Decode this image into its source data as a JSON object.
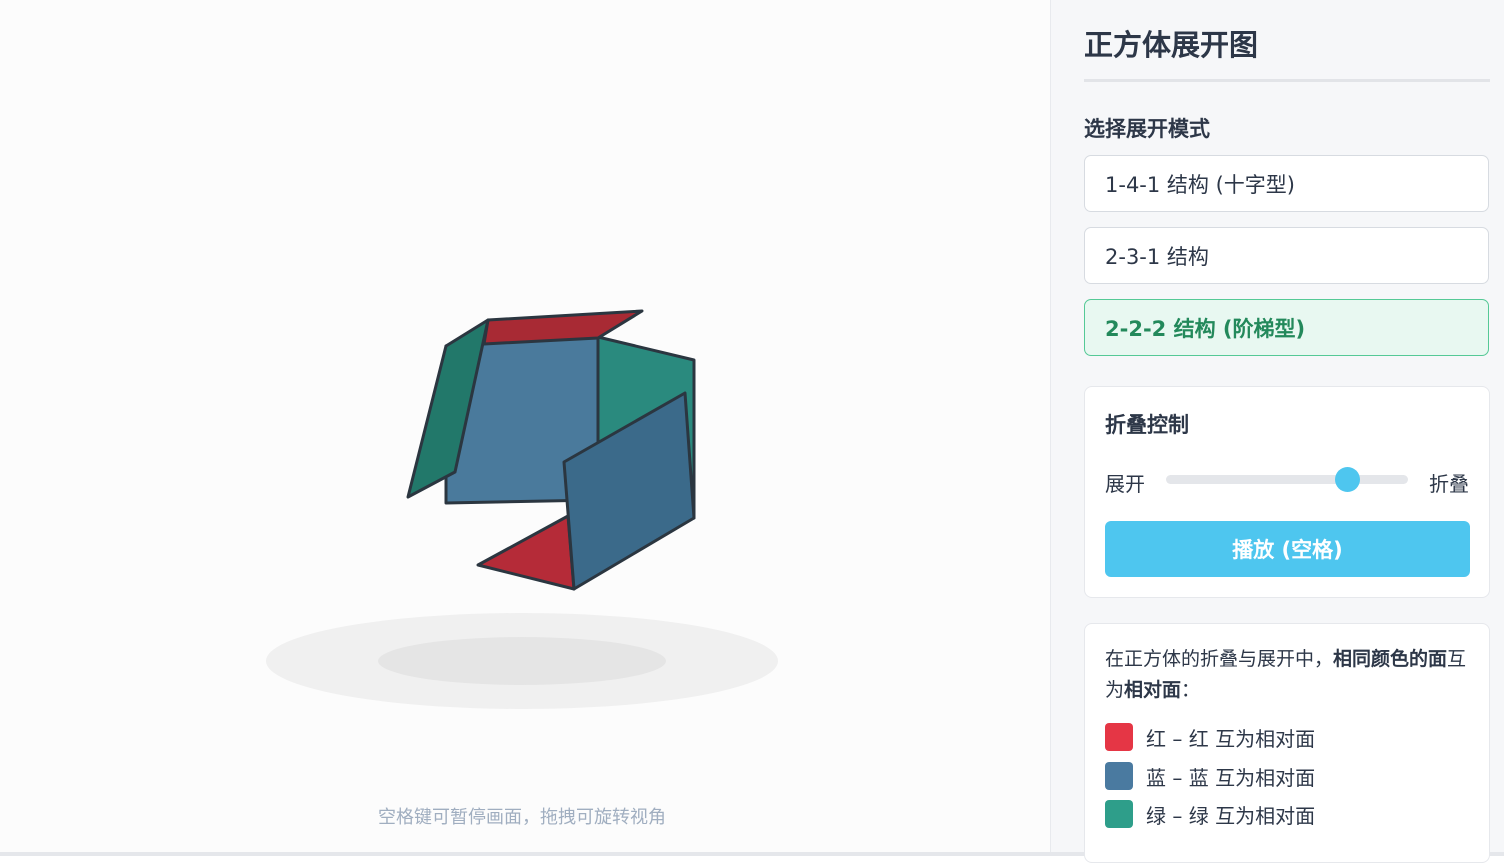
{
  "stage": {
    "hint": "空格键可暂停画面，拖拽可旋转视角",
    "faces": [
      {
        "name": "left-face",
        "color": "#22786a"
      },
      {
        "name": "top-face",
        "color": "#a82a34"
      },
      {
        "name": "back-face",
        "color": "#4a7a9c"
      },
      {
        "name": "right-face",
        "color": "#2a8a7e"
      },
      {
        "name": "front-face",
        "color": "#3b6a8a"
      },
      {
        "name": "bottom-face",
        "color": "#b52b38"
      }
    ]
  },
  "panel": {
    "title": "正方体展开图",
    "mode_label": "选择展开模式",
    "modes": [
      {
        "label": "1-4-1 结构 (十字型)",
        "active": false
      },
      {
        "label": "2-3-1 结构",
        "active": false
      },
      {
        "label": "2-2-2 结构 (阶梯型)",
        "active": true
      }
    ],
    "fold": {
      "title": "折叠控制",
      "min_label": "展开",
      "max_label": "折叠",
      "value": 0.75,
      "play_label": "播放 (空格)"
    },
    "info": {
      "text_prefix": "在正方体的折叠与展开中，",
      "text_bold1": "相同颜色的面",
      "text_middle": "互为",
      "text_bold2": "相对面",
      "text_suffix": "：",
      "legend": [
        {
          "label": "红 – 红 互为相对面",
          "color": "#e53645"
        },
        {
          "label": "蓝 – 蓝 互为相对面",
          "color": "#4a7aa0"
        },
        {
          "label": "绿 – 绿 互为相对面",
          "color": "#2e9e8a"
        }
      ]
    }
  }
}
